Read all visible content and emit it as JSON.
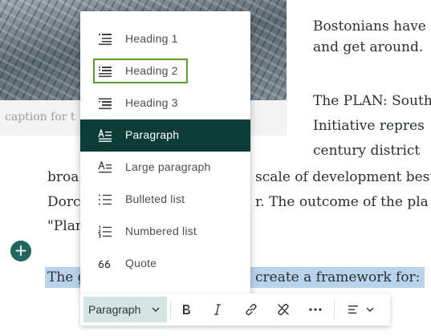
{
  "article": {
    "caption_fragment": "caption for t",
    "right_lines": [
      "Bostonians have",
      "and get around.",
      "The PLAN: South",
      "Initiative repres",
      "century district"
    ],
    "line_broa": "broa",
    "line_broa_right": "scale of development best",
    "line_dorc": "Dorc",
    "line_dorc_right": "r. The outcome of the pla",
    "line_plan": "\"Plan",
    "selected_left": "The g",
    "selected_right": "create a framework for:"
  },
  "add_button": {
    "symbol": "+"
  },
  "menu": {
    "items": [
      {
        "label": "Heading 1",
        "icon": "heading-1-icon"
      },
      {
        "label": "Heading 2",
        "icon": "heading-2-icon"
      },
      {
        "label": "Heading 3",
        "icon": "heading-3-icon"
      },
      {
        "label": "Paragraph",
        "icon": "paragraph-icon"
      },
      {
        "label": "Large paragraph",
        "icon": "large-paragraph-icon"
      },
      {
        "label": "Bulleted list",
        "icon": "bulleted-list-icon"
      },
      {
        "label": "Numbered list",
        "icon": "numbered-list-icon"
      },
      {
        "label": "Quote",
        "icon": "quote-icon"
      }
    ],
    "active_item": "Paragraph",
    "focused_item": "Heading 2"
  },
  "toolbar": {
    "block_type": "Paragraph",
    "buttons": [
      "bold-icon",
      "italic-icon",
      "link-icon",
      "unlink-icon",
      "more-icon",
      "align-icon"
    ]
  },
  "colors": {
    "menu_active_bg": "#0c3d36",
    "focus_ring": "#5e9c2c",
    "selection": "#b9d3ec",
    "add_button": "#1f6660",
    "toolbar_select_bg": "#d3e6e3"
  }
}
